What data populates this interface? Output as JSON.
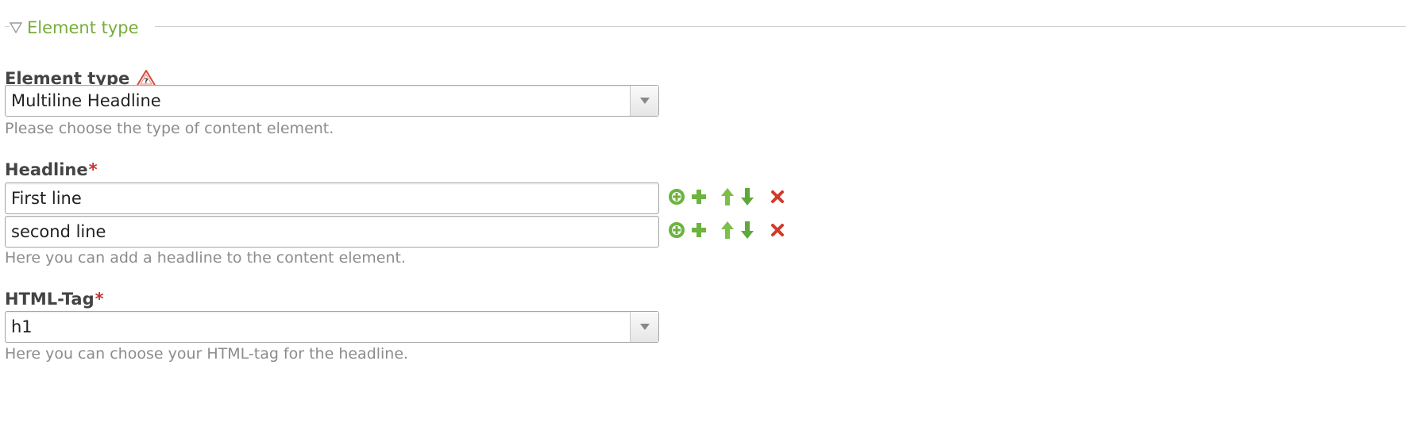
{
  "section": {
    "legend_title": "Element type"
  },
  "element_type": {
    "label": "Element type",
    "selected": "Multiline Headline",
    "help": "Please choose the type of content element."
  },
  "headline": {
    "label": "Headline",
    "required_mark": "*",
    "rows": [
      {
        "value": "First line"
      },
      {
        "value": "second line"
      }
    ],
    "help": "Here you can add a headline to the content element."
  },
  "html_tag": {
    "label": "HTML-Tag",
    "required_mark": "*",
    "selected": "h1",
    "help": "Here you can choose your HTML-tag for the headline."
  },
  "icons": {
    "legend_toggle": "triangle-down-outline-icon",
    "help_warning": "warning-help-icon",
    "copy": "circle-plus-icon",
    "add": "plus-icon",
    "move_up": "arrow-up-icon",
    "move_down": "arrow-down-icon",
    "delete": "delete-x-icon"
  },
  "colors": {
    "legend_green": "#77ac3b",
    "required_red": "#c33333",
    "help_gray": "#8c8c8c",
    "label_dark": "#444444",
    "action_green": "#6cb33f",
    "delete_red": "#d23a2a"
  }
}
